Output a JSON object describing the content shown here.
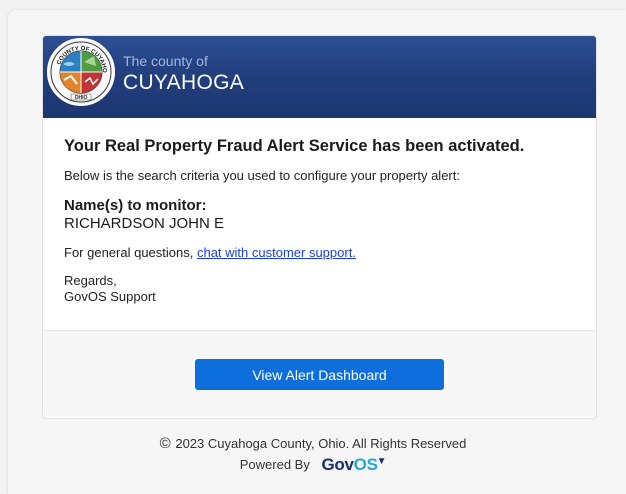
{
  "header": {
    "subtitle": "The county of",
    "title": "CUYAHOGA",
    "seal_text_top": "COUNTY OF CUYAHOGA",
    "seal_text_bottom": "OHIO"
  },
  "message": {
    "heading": "Your Real Property Fraud Alert Service has been activated.",
    "intro": "Below is the search criteria you used to configure your property alert:",
    "monitor_label": "Name(s) to monitor:",
    "monitor_value": "RICHARDSON JOHN E",
    "support_prefix": "For general questions, ",
    "support_link": "chat with customer support.",
    "regards_line1": "Regards,",
    "regards_line2": "GovOS Support"
  },
  "actions": {
    "dashboard_button": "View Alert Dashboard"
  },
  "footer": {
    "copyright_icon": "©",
    "copyright": "2023 Cuyahoga County, Ohio. All Rights Reserved",
    "powered_by": "Powered By",
    "logo_part1": "Gov",
    "logo_part2": "OS",
    "logo_mark": "▼"
  },
  "colors": {
    "header_bg": "#213e7d",
    "button_bg": "#0d6edc",
    "link": "#1a3fe0",
    "logo_dark": "#1a2f68",
    "logo_light": "#22a6d9"
  }
}
